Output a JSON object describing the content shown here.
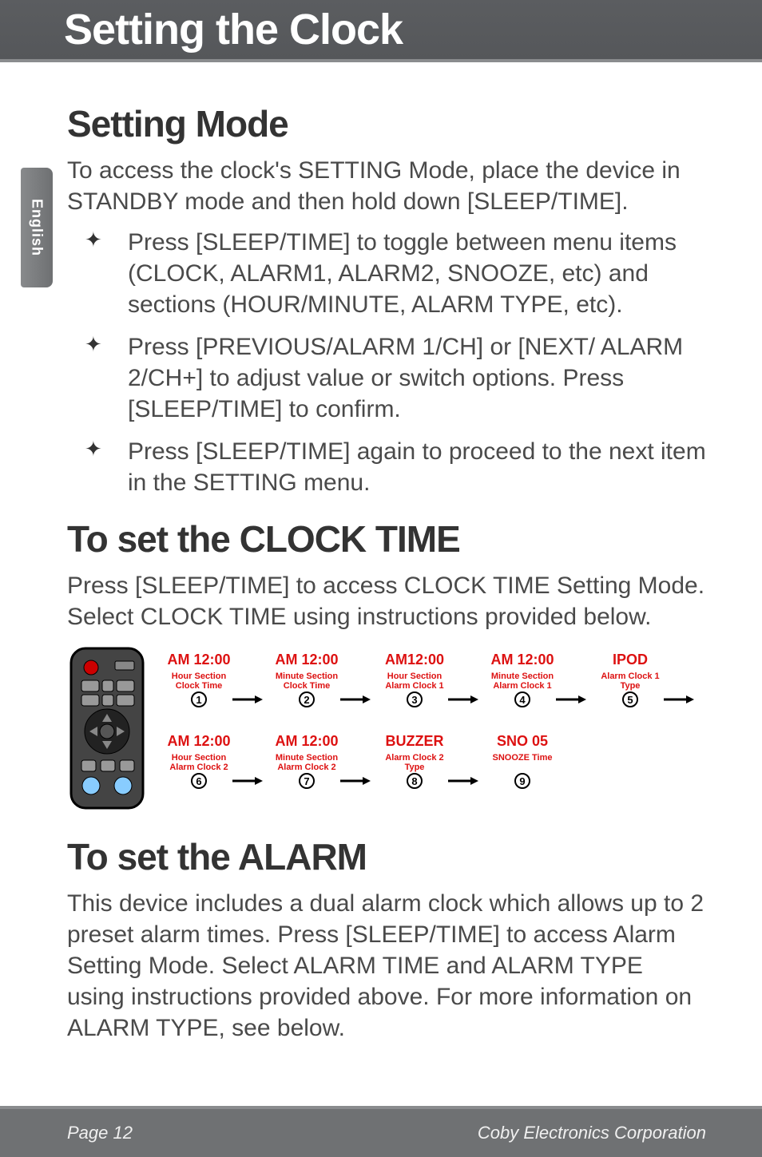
{
  "title": "Setting the Clock",
  "language_tab": "English",
  "section1": {
    "heading": "Setting Mode",
    "intro": "To access the clock's SETTING Mode, place the device in STANDBY mode and then hold down [SLEEP/TIME].",
    "bullets": [
      "Press [SLEEP/TIME] to toggle between menu items (CLOCK, ALARM1, ALARM2, SNOOZE, etc) and sections (HOUR/MINUTE, ALARM TYPE, etc).",
      "Press [PREVIOUS/ALARM 1/CH] or [NEXT/ ALARM 2/CH+] to adjust value or switch options. Press [SLEEP/TIME] to confirm.",
      "Press [SLEEP/TIME] again to proceed to the next item in the SETTING menu."
    ]
  },
  "section2": {
    "heading": "To set the CLOCK TIME",
    "body": "Press [SLEEP/TIME] to access CLOCK TIME Setting Mode. Select CLOCK TIME using instructions provided below."
  },
  "diagram": {
    "row1": [
      {
        "num": "1",
        "top": "AM 12:00",
        "l1": "Hour Section",
        "l2": "Clock Time"
      },
      {
        "num": "2",
        "top": "AM 12:00",
        "l1": "Minute Section",
        "l2": "Clock Time"
      },
      {
        "num": "3",
        "top": "AM12:00",
        "l1": "Hour Section",
        "l2": "Alarm Clock 1"
      },
      {
        "num": "4",
        "top": "AM 12:00",
        "l1": "Minute Section",
        "l2": "Alarm Clock 1"
      },
      {
        "num": "5",
        "top": "IPOD",
        "l1": "Alarm Clock 1",
        "l2": "Type"
      }
    ],
    "row2": [
      {
        "num": "6",
        "top": "AM 12:00",
        "l1": "Hour Section",
        "l2": "Alarm Clock 2"
      },
      {
        "num": "7",
        "top": "AM 12:00",
        "l1": "Minute Section",
        "l2": "Alarm Clock 2"
      },
      {
        "num": "8",
        "top": "BUZZER",
        "l1": "Alarm Clock 2",
        "l2": "Type"
      },
      {
        "num": "9",
        "top": "SNO 05",
        "l1": "SNOOZE Time",
        "l2": ""
      }
    ]
  },
  "section3": {
    "heading": "To set the ALARM",
    "body": "This device includes a dual alarm clock which allows up to 2 preset alarm times. Press [SLEEP/TIME]  to access Alarm Setting Mode. Select ALARM TIME and ALARM TYPE using instructions provided above.  For more information on ALARM TYPE, see below."
  },
  "footer": {
    "left": "Page 12",
    "right": "Coby Electronics Corporation"
  }
}
